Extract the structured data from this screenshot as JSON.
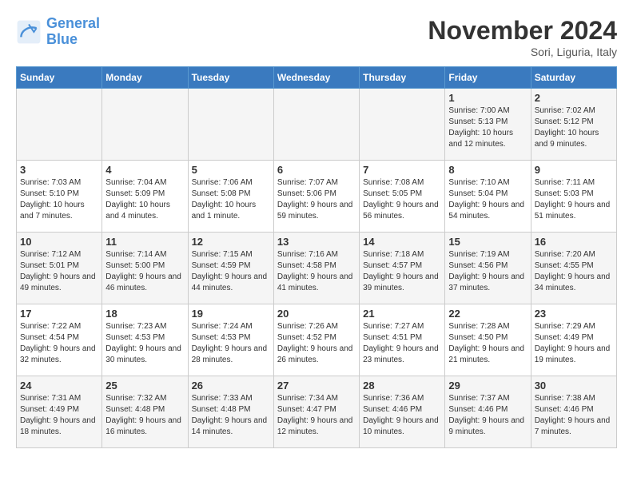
{
  "header": {
    "logo_line1": "General",
    "logo_line2": "Blue",
    "month_title": "November 2024",
    "subtitle": "Sori, Liguria, Italy"
  },
  "days_of_week": [
    "Sunday",
    "Monday",
    "Tuesday",
    "Wednesday",
    "Thursday",
    "Friday",
    "Saturday"
  ],
  "weeks": [
    [
      {
        "num": "",
        "detail": ""
      },
      {
        "num": "",
        "detail": ""
      },
      {
        "num": "",
        "detail": ""
      },
      {
        "num": "",
        "detail": ""
      },
      {
        "num": "",
        "detail": ""
      },
      {
        "num": "1",
        "detail": "Sunrise: 7:00 AM\nSunset: 5:13 PM\nDaylight: 10 hours and 12 minutes."
      },
      {
        "num": "2",
        "detail": "Sunrise: 7:02 AM\nSunset: 5:12 PM\nDaylight: 10 hours and 9 minutes."
      }
    ],
    [
      {
        "num": "3",
        "detail": "Sunrise: 7:03 AM\nSunset: 5:10 PM\nDaylight: 10 hours and 7 minutes."
      },
      {
        "num": "4",
        "detail": "Sunrise: 7:04 AM\nSunset: 5:09 PM\nDaylight: 10 hours and 4 minutes."
      },
      {
        "num": "5",
        "detail": "Sunrise: 7:06 AM\nSunset: 5:08 PM\nDaylight: 10 hours and 1 minute."
      },
      {
        "num": "6",
        "detail": "Sunrise: 7:07 AM\nSunset: 5:06 PM\nDaylight: 9 hours and 59 minutes."
      },
      {
        "num": "7",
        "detail": "Sunrise: 7:08 AM\nSunset: 5:05 PM\nDaylight: 9 hours and 56 minutes."
      },
      {
        "num": "8",
        "detail": "Sunrise: 7:10 AM\nSunset: 5:04 PM\nDaylight: 9 hours and 54 minutes."
      },
      {
        "num": "9",
        "detail": "Sunrise: 7:11 AM\nSunset: 5:03 PM\nDaylight: 9 hours and 51 minutes."
      }
    ],
    [
      {
        "num": "10",
        "detail": "Sunrise: 7:12 AM\nSunset: 5:01 PM\nDaylight: 9 hours and 49 minutes."
      },
      {
        "num": "11",
        "detail": "Sunrise: 7:14 AM\nSunset: 5:00 PM\nDaylight: 9 hours and 46 minutes."
      },
      {
        "num": "12",
        "detail": "Sunrise: 7:15 AM\nSunset: 4:59 PM\nDaylight: 9 hours and 44 minutes."
      },
      {
        "num": "13",
        "detail": "Sunrise: 7:16 AM\nSunset: 4:58 PM\nDaylight: 9 hours and 41 minutes."
      },
      {
        "num": "14",
        "detail": "Sunrise: 7:18 AM\nSunset: 4:57 PM\nDaylight: 9 hours and 39 minutes."
      },
      {
        "num": "15",
        "detail": "Sunrise: 7:19 AM\nSunset: 4:56 PM\nDaylight: 9 hours and 37 minutes."
      },
      {
        "num": "16",
        "detail": "Sunrise: 7:20 AM\nSunset: 4:55 PM\nDaylight: 9 hours and 34 minutes."
      }
    ],
    [
      {
        "num": "17",
        "detail": "Sunrise: 7:22 AM\nSunset: 4:54 PM\nDaylight: 9 hours and 32 minutes."
      },
      {
        "num": "18",
        "detail": "Sunrise: 7:23 AM\nSunset: 4:53 PM\nDaylight: 9 hours and 30 minutes."
      },
      {
        "num": "19",
        "detail": "Sunrise: 7:24 AM\nSunset: 4:53 PM\nDaylight: 9 hours and 28 minutes."
      },
      {
        "num": "20",
        "detail": "Sunrise: 7:26 AM\nSunset: 4:52 PM\nDaylight: 9 hours and 26 minutes."
      },
      {
        "num": "21",
        "detail": "Sunrise: 7:27 AM\nSunset: 4:51 PM\nDaylight: 9 hours and 23 minutes."
      },
      {
        "num": "22",
        "detail": "Sunrise: 7:28 AM\nSunset: 4:50 PM\nDaylight: 9 hours and 21 minutes."
      },
      {
        "num": "23",
        "detail": "Sunrise: 7:29 AM\nSunset: 4:49 PM\nDaylight: 9 hours and 19 minutes."
      }
    ],
    [
      {
        "num": "24",
        "detail": "Sunrise: 7:31 AM\nSunset: 4:49 PM\nDaylight: 9 hours and 18 minutes."
      },
      {
        "num": "25",
        "detail": "Sunrise: 7:32 AM\nSunset: 4:48 PM\nDaylight: 9 hours and 16 minutes."
      },
      {
        "num": "26",
        "detail": "Sunrise: 7:33 AM\nSunset: 4:48 PM\nDaylight: 9 hours and 14 minutes."
      },
      {
        "num": "27",
        "detail": "Sunrise: 7:34 AM\nSunset: 4:47 PM\nDaylight: 9 hours and 12 minutes."
      },
      {
        "num": "28",
        "detail": "Sunrise: 7:36 AM\nSunset: 4:46 PM\nDaylight: 9 hours and 10 minutes."
      },
      {
        "num": "29",
        "detail": "Sunrise: 7:37 AM\nSunset: 4:46 PM\nDaylight: 9 hours and 9 minutes."
      },
      {
        "num": "30",
        "detail": "Sunrise: 7:38 AM\nSunset: 4:46 PM\nDaylight: 9 hours and 7 minutes."
      }
    ]
  ]
}
